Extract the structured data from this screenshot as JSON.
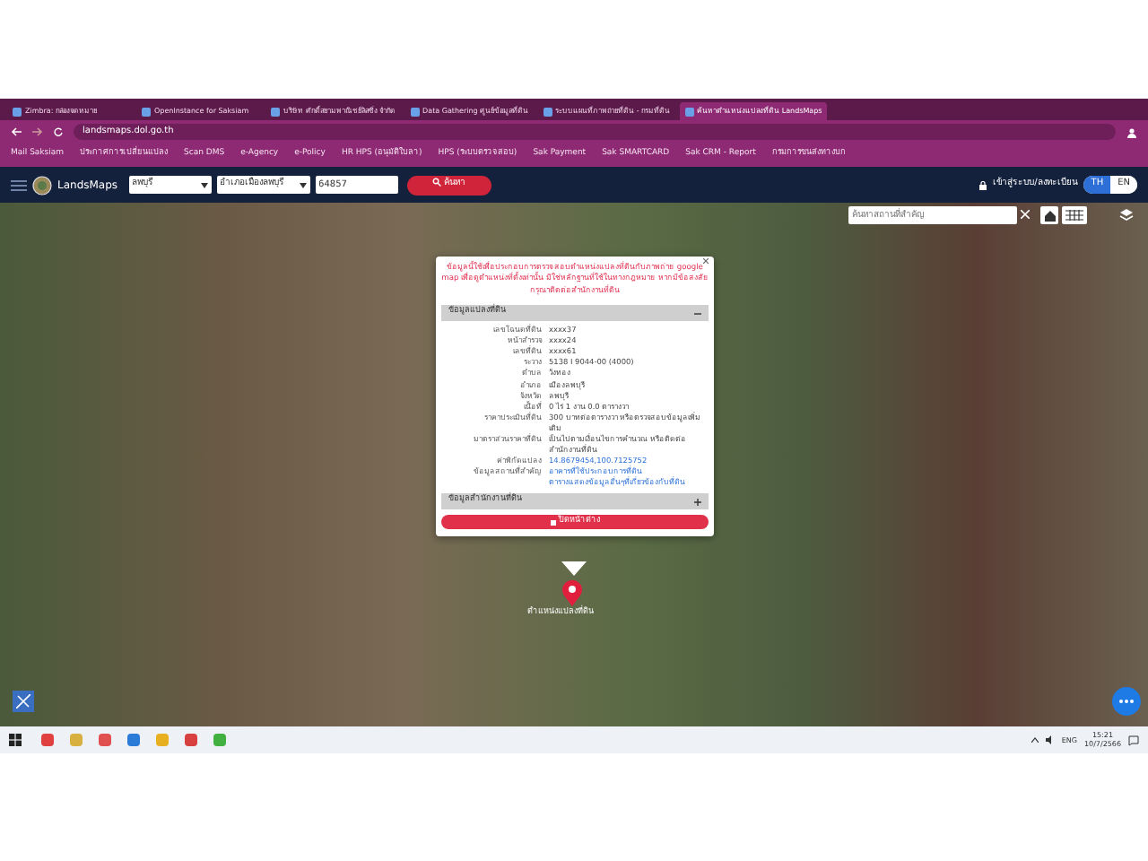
{
  "browser": {
    "tabs": [
      {
        "title": "Zimbra: กล่องจดหมาย",
        "selected": false
      },
      {
        "title": "OpenInstance for Saksiam",
        "selected": false
      },
      {
        "title": "บริษัท ศักดิ์สยามพาณิชย์ลิสซิ่ง จำกัด",
        "selected": false
      },
      {
        "title": "Data Gathering ศูนย์ข้อมูลที่ดิน",
        "selected": false
      },
      {
        "title": "ระบบแผนที่ภาพถ่ายที่ดิน - กรมที่ดิน",
        "selected": false
      },
      {
        "title": "ค้นหาตำแหน่งแปลงที่ดิน LandsMaps",
        "selected": true
      }
    ],
    "address": "landsmaps.dol.go.th",
    "bookmarks": [
      "Mail Saksiam",
      "ประกาศการเปลี่ยนแปลง",
      "Scan DMS",
      "e-Agency",
      "e-Policy",
      "HR HPS (อนุมัติใบลา)",
      "HPS (ระบบตรวจสอบ)",
      "Sak Payment",
      "Sak SMARTCARD",
      "Sak CRM - Report",
      "กรมการขนส่งทางบก"
    ]
  },
  "app": {
    "logo": "LandsMaps",
    "province": "ลพบุรี",
    "district": "อำเภอเมืองลพบุรี",
    "parcel_number": "64857",
    "search_button": "ค้นหา",
    "login": "เข้าสู่ระบบ/ลงทะเบียน",
    "languages": [
      {
        "label": "TH",
        "selected": true
      },
      {
        "label": "EN",
        "selected": false
      }
    ],
    "place_search": {
      "placeholder": "ค้นหาสถานที่สำคัญ"
    }
  },
  "popup": {
    "warning": "ข้อมูลนี้ใช้เพื่อประกอบการตรวจสอบตำแหน่งแปลงที่ดินกับภาพถ่าย google map เพื่อดูตำแหน่งที่ตั้งเท่านั้น มิใช่หลักฐานที่ใช้ในทางกฎหมาย หากมีข้อสงสัย กรุณาติดต่อสำนักงานที่ดิน",
    "sections": [
      {
        "title": "ข้อมูลแปลงที่ดิน",
        "expanded": true,
        "rows": [
          {
            "label": "เลขโฉนดที่ดิน",
            "value": "xxxx37",
            "kind": "text"
          },
          {
            "label": "หน้าสำรวจ",
            "value": "xxxx24",
            "kind": "text"
          },
          {
            "label": "เลขที่ดิน",
            "value": "xxxx61",
            "kind": "text"
          },
          {
            "label": "ระวาง",
            "value": "5138 I 9044-00 (4000)",
            "kind": "text"
          },
          {
            "label": "ตำบล",
            "value": "วังทอง",
            "kind": "text"
          },
          {
            "label": "อำเภอ",
            "value": "เมืองลพบุรี",
            "kind": "text"
          },
          {
            "label": "จังหวัด",
            "value": "ลพบุรี",
            "kind": "text"
          },
          {
            "label": "เนื้อที่",
            "value": "0 ไร่ 1 งาน 0.0 ตารางวา",
            "kind": "text"
          },
          {
            "label": "ราคาประเมินที่ดิน",
            "value": "300 บาทต่อตารางวา หรือตรวจสอบข้อมูลเพิ่มเติม",
            "kind": "text"
          },
          {
            "label": "มาตราส่วนราคาที่ดิน",
            "value": "เป็นไปตามเงื่อนไขการคำนวณ หรือติดต่อสำนักงานที่ดิน",
            "kind": "text"
          },
          {
            "label": "ค่าพิกัดแปลง",
            "value": "14.8679454,100.7125752",
            "kind": "link"
          },
          {
            "label": "ข้อมูลสถานที่สำคัญ",
            "value": "อาคารที่ใช้ประกอบการที่ดิน",
            "kind": "link"
          },
          {
            "label": "",
            "value": "ตารางแสดงข้อมูลอื่นๆที่เกี่ยวข้องกับที่ดิน",
            "kind": "link"
          }
        ]
      },
      {
        "title": "ข้อมูลสำนักงานที่ดิน",
        "expanded": false
      }
    ],
    "close_button": "ปิดหน้าต่าง"
  },
  "marker_label": "ตำแหน่งแปลงที่ดิน",
  "taskbar": {
    "language": "ENG",
    "time": "15:21",
    "date": "10/7/2566"
  }
}
